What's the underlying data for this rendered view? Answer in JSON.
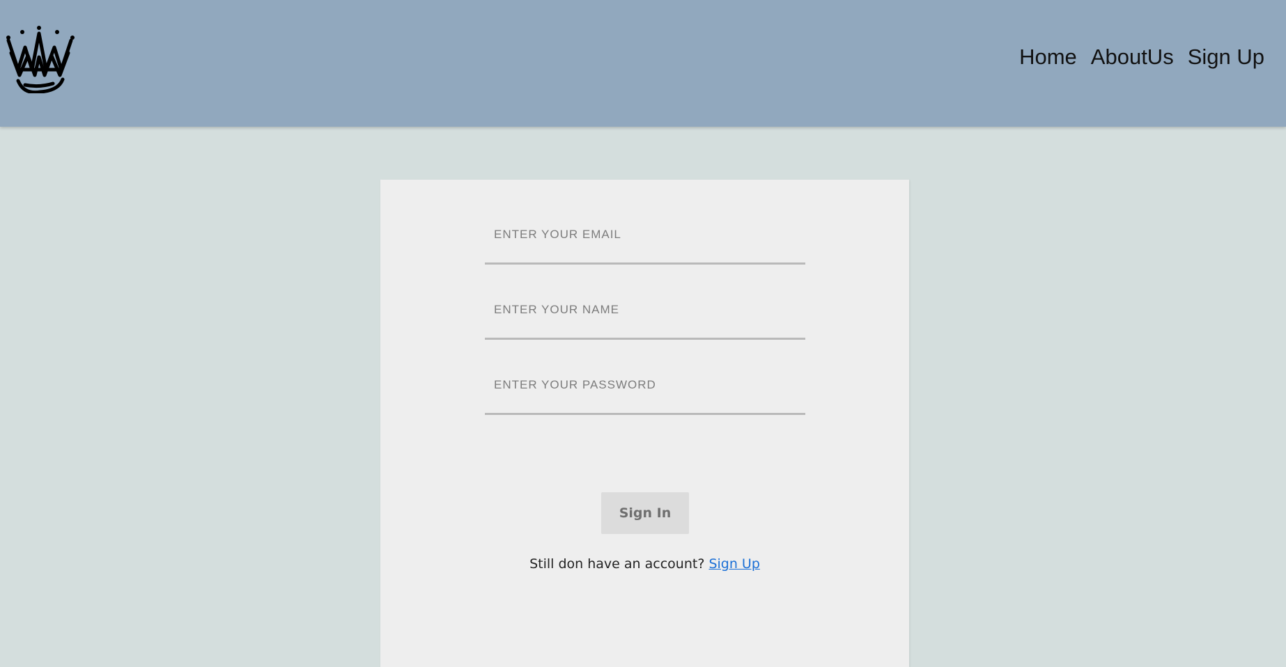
{
  "header": {
    "logo_icon": "crown-icon",
    "nav": {
      "home": "Home",
      "about": "AboutUs",
      "signup": "Sign Up"
    },
    "background": "#91a8be"
  },
  "form": {
    "email_placeholder": "ENTER YOUR EMAIL",
    "name_placeholder": "ENTER YOUR NAME",
    "password_placeholder": "ENTER YOUR PASSWORD",
    "email_value": "",
    "name_value": "",
    "password_value": "",
    "submit_label": "Sign In",
    "prompt_text": "Still don have an account?",
    "signup_link": "Sign Up"
  },
  "colors": {
    "page_background": "#d4dedd",
    "card_background": "#eeeeee",
    "link": "#1a6fd6"
  }
}
